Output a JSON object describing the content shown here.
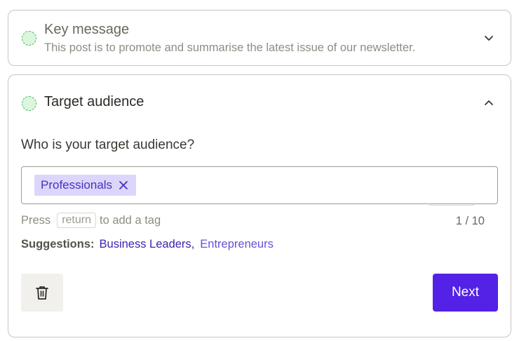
{
  "key_message": {
    "title": "Key message",
    "subtitle": "This post is to promote and summarise the latest issue of our newsletter.",
    "chevron": "chevron-down-icon"
  },
  "target_audience": {
    "title": "Target audience",
    "chevron": "chevron-up-icon",
    "question": "Who is your target audience?",
    "tags": [
      {
        "label": "Professionals",
        "remove_icon": "close-icon"
      }
    ],
    "input_value": "",
    "hint_prefix": "Press",
    "hint_key": "return",
    "hint_suffix": "to add a tag",
    "counter": "1 / 10",
    "suggestions_label": "Suggestions:",
    "suggestions": [
      "Business Leaders",
      "Entrepreneurs"
    ],
    "suggestion_separator": ",",
    "delete_icon": "trash-icon",
    "next_label": "Next"
  },
  "colors": {
    "accent": "#5421e6",
    "tag_bg": "#ddd6fb",
    "tag_text": "#4b2fc0",
    "status_dot": "#dcf5dd",
    "status_dot_border": "#49b85b",
    "border": "#c9c6bd"
  }
}
